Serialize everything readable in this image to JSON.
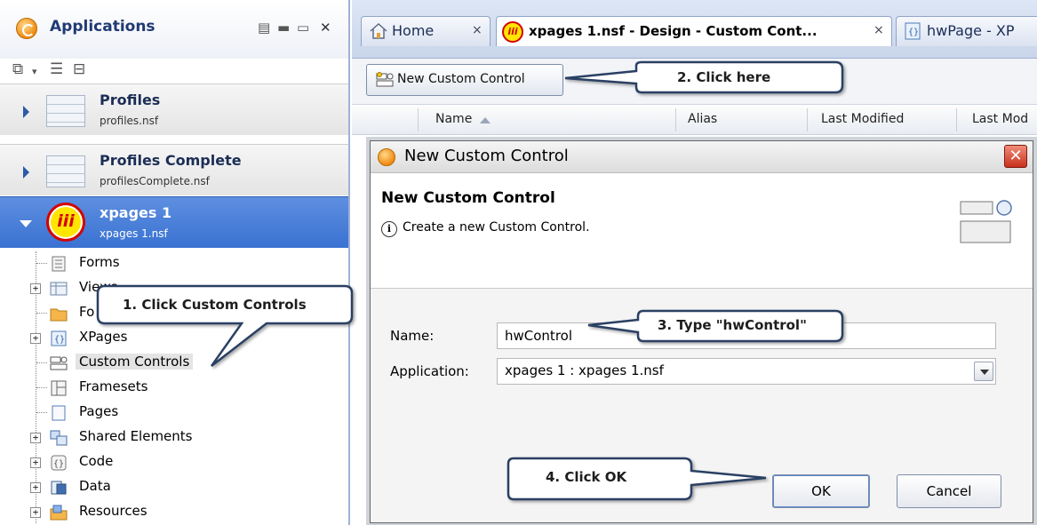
{
  "left_panel": {
    "title": "Applications",
    "databases": [
      {
        "title": "Profiles",
        "file": "profiles.nsf"
      },
      {
        "title": "Profiles Complete",
        "file": "profilesComplete.nsf"
      },
      {
        "title": "xpages 1",
        "file": "xpages 1.nsf",
        "logo_text": "iii"
      }
    ],
    "tree": [
      {
        "label": "Forms",
        "icon": "form-icon"
      },
      {
        "label": "Views",
        "icon": "view-icon"
      },
      {
        "label": "Fo",
        "icon": "folder-icon"
      },
      {
        "label": "XPages",
        "icon": "xpages-icon"
      },
      {
        "label": "Custom Controls",
        "icon": "custom-control-icon"
      },
      {
        "label": "Framesets",
        "icon": "frameset-icon"
      },
      {
        "label": "Pages",
        "icon": "page-icon"
      },
      {
        "label": "Shared Elements",
        "icon": "shared-elements-icon"
      },
      {
        "label": "Code",
        "icon": "code-icon"
      },
      {
        "label": "Data",
        "icon": "data-icon"
      },
      {
        "label": "Resources",
        "icon": "resources-icon"
      }
    ]
  },
  "tabs": [
    {
      "label": "Home",
      "close": "×"
    },
    {
      "label": "xpages 1.nsf - Design - Custom Cont...",
      "close": "×"
    },
    {
      "label": "hwPage - XP"
    }
  ],
  "editor": {
    "new_button_label": "New Custom Control",
    "columns": [
      "Name",
      "Alias",
      "Last Modified",
      "Last Mod"
    ]
  },
  "dialog": {
    "title": "New Custom Control",
    "close": "✕",
    "header_title": "New Custom Control",
    "header_message": "Create a new Custom Control.",
    "info_icon": "i",
    "name_label": "Name:",
    "name_value": "hwControl",
    "application_label": "Application:",
    "application_value": "xpages 1 : xpages 1.nsf",
    "ok_label": "OK",
    "cancel_label": "Cancel"
  },
  "callouts": {
    "step1": "1. Click Custom Controls",
    "step2": "2. Click here",
    "step3": "3. Type \"hwControl\"",
    "step4": "4. Click OK"
  },
  "colors": {
    "selection_blue": "#3a72d2",
    "title_blue": "#213a74",
    "callout_fill": "#ffffff",
    "callout_stroke": "#2c3f63",
    "close_red": "#c9301c"
  }
}
